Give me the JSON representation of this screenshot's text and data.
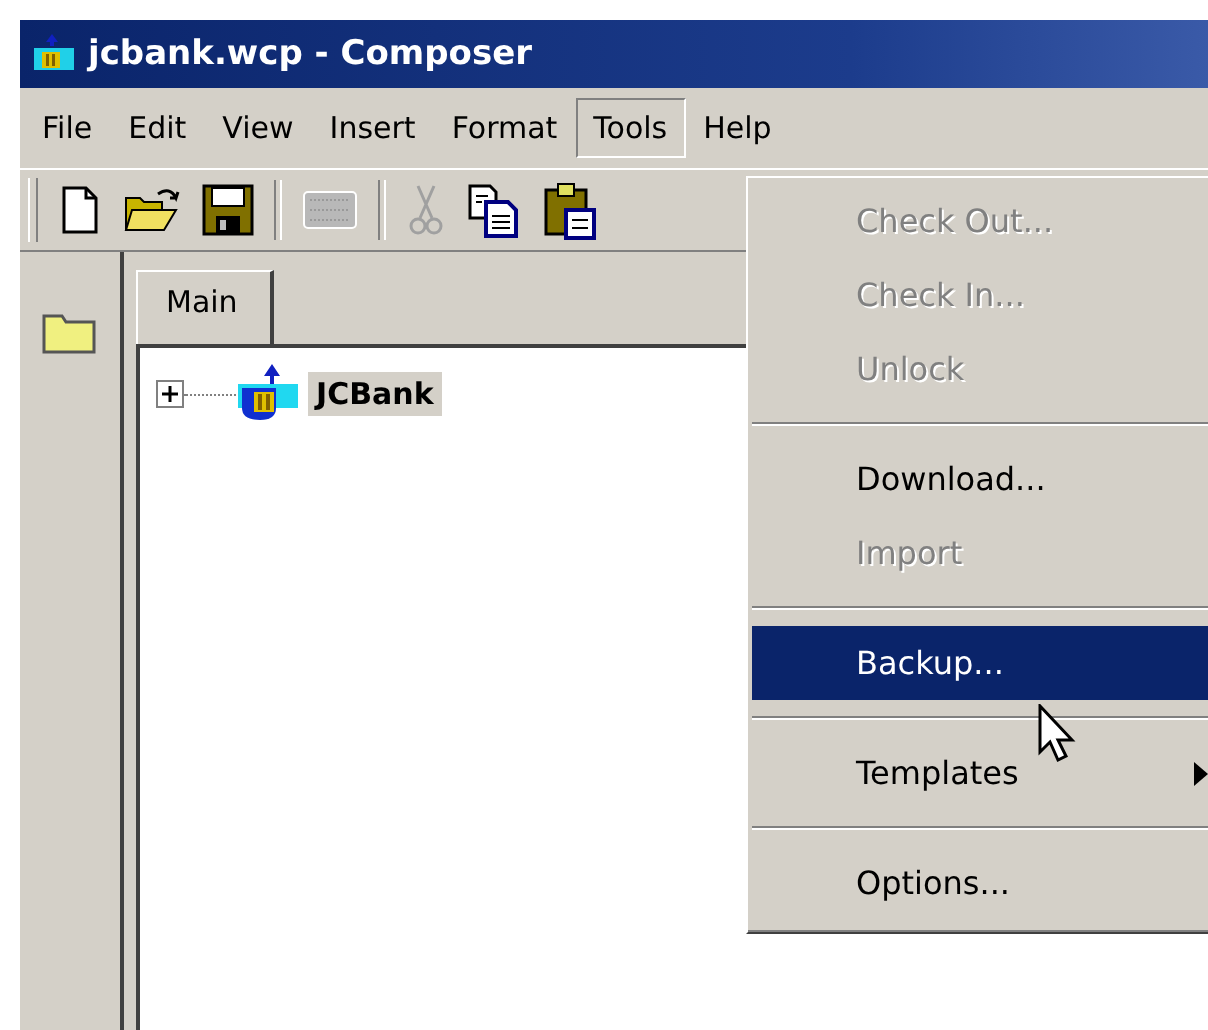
{
  "window": {
    "title": "jcbank.wcp - Composer"
  },
  "menu_bar": [
    {
      "label": "File",
      "selected": false
    },
    {
      "label": "Edit",
      "selected": false
    },
    {
      "label": "View",
      "selected": false
    },
    {
      "label": "Insert",
      "selected": false
    },
    {
      "label": "Format",
      "selected": false
    },
    {
      "label": "Tools",
      "selected": true
    },
    {
      "label": "Help",
      "selected": false
    }
  ],
  "toolbar": [
    {
      "kind": "new"
    },
    {
      "kind": "open"
    },
    {
      "kind": "save"
    },
    {
      "kind": "separator"
    },
    {
      "kind": "grid",
      "disabled": true
    },
    {
      "kind": "separator"
    },
    {
      "kind": "cut",
      "disabled": true
    },
    {
      "kind": "copy"
    },
    {
      "kind": "paste"
    }
  ],
  "tabs": [
    {
      "label": "Main",
      "selected": true
    }
  ],
  "tree": [
    {
      "label": "JCBank",
      "expanded": false,
      "selected": true
    }
  ],
  "tools_menu": [
    {
      "kind": "item",
      "label": "Check Out...",
      "disabled": true,
      "selected": false,
      "submenu": false
    },
    {
      "kind": "item",
      "label": "Check In...",
      "disabled": true,
      "selected": false,
      "submenu": false
    },
    {
      "kind": "item",
      "label": "Unlock",
      "disabled": true,
      "selected": false,
      "submenu": false
    },
    {
      "kind": "separator"
    },
    {
      "kind": "item",
      "label": "Download...",
      "disabled": false,
      "selected": false,
      "submenu": false
    },
    {
      "kind": "item",
      "label": "Import",
      "disabled": true,
      "selected": false,
      "submenu": false
    },
    {
      "kind": "separator"
    },
    {
      "kind": "item",
      "label": "Backup...",
      "disabled": false,
      "selected": true,
      "submenu": false
    },
    {
      "kind": "separator"
    },
    {
      "kind": "item",
      "label": "Templates",
      "disabled": false,
      "selected": false,
      "submenu": true
    },
    {
      "kind": "separator"
    },
    {
      "kind": "item",
      "label": "Options...",
      "disabled": false,
      "selected": false,
      "submenu": false
    }
  ]
}
